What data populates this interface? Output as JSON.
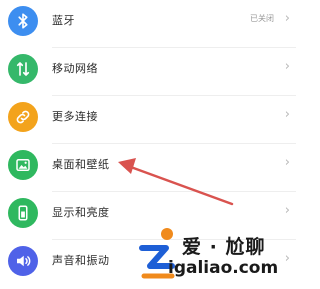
{
  "settings": {
    "items": [
      {
        "label": "蓝牙",
        "value": "已关闭",
        "icon": "bluetooth-icon",
        "color": "#3d8ef0"
      },
      {
        "label": "移动网络",
        "value": "",
        "icon": "mobile-network-icon",
        "color": "#35b86a"
      },
      {
        "label": "更多连接",
        "value": "",
        "icon": "link-icon",
        "color": "#f3a31c"
      },
      {
        "label": "桌面和壁纸",
        "value": "",
        "icon": "wallpaper-icon",
        "color": "#2fb85f"
      },
      {
        "label": "显示和亮度",
        "value": "",
        "icon": "display-icon",
        "color": "#2fb85f"
      },
      {
        "label": "声音和振动",
        "value": "",
        "icon": "sound-icon",
        "color": "#4f62e8"
      }
    ]
  },
  "watermark": {
    "text": "爱 · 尬聊",
    "url": "igaliao.com"
  },
  "annotation": {
    "arrow_color": "#d9534f"
  }
}
